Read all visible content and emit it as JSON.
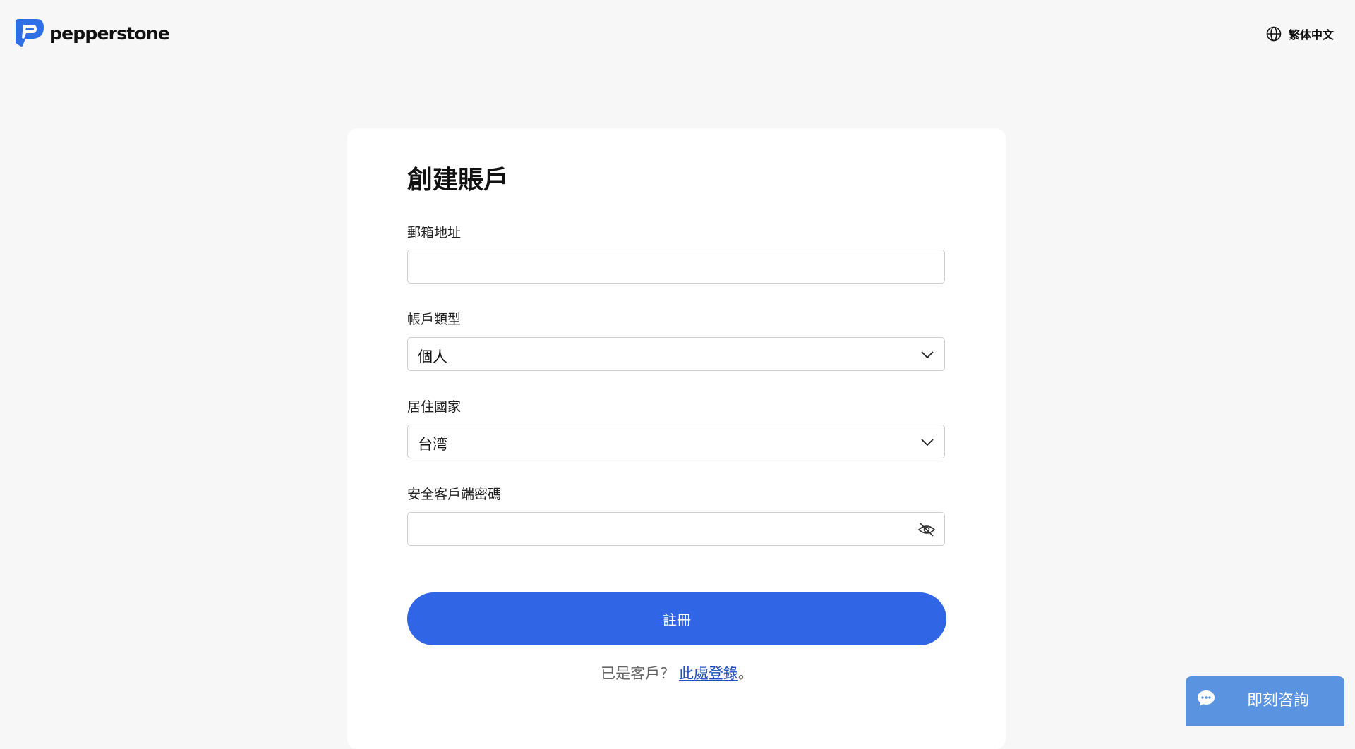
{
  "header": {
    "brand_name": "pepperstone",
    "language_label": "繁体中文"
  },
  "form": {
    "title": "創建賬戶",
    "email": {
      "label": "郵箱地址",
      "value": "",
      "placeholder": ""
    },
    "account_type": {
      "label": "帳戶類型",
      "value": "個人"
    },
    "country": {
      "label": "居住國家",
      "value": "台湾"
    },
    "password": {
      "label": "安全客戶端密碼",
      "value": "",
      "placeholder": ""
    },
    "submit_label": "註冊",
    "login_prefix": "已是客戶？",
    "login_link": "此處登錄",
    "login_suffix": "。"
  },
  "chat": {
    "label": "即刻咨詢",
    "icon": "chat-bubble-icon"
  },
  "colors": {
    "page_background": "#f7f7f7",
    "primary_button": "#3066e6",
    "chat_widget": "#5a93e0",
    "brand_logo": "#2f6fe6",
    "link": "#1f4fbf"
  }
}
